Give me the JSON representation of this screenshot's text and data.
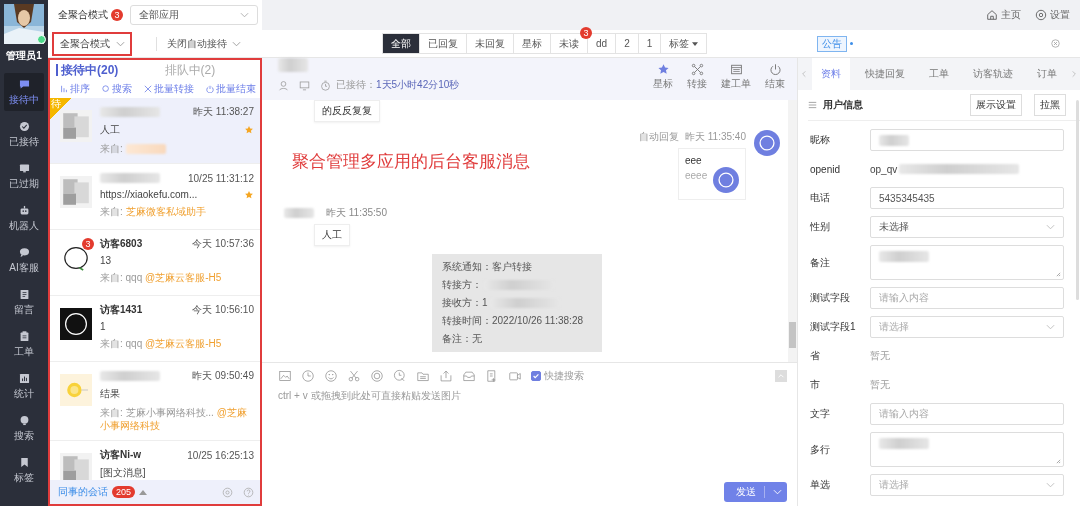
{
  "sidebar": {
    "user": "管理员1",
    "online": true,
    "items": [
      {
        "label": "接待中",
        "selected": true
      },
      {
        "label": "已接待",
        "selected": false
      },
      {
        "label": "已过期",
        "selected": false
      },
      {
        "label": "机器人",
        "selected": false
      },
      {
        "label": "AI客服",
        "selected": false
      },
      {
        "label": "留言",
        "selected": false
      },
      {
        "label": "工单",
        "selected": false
      },
      {
        "label": "统计",
        "selected": false
      },
      {
        "label": "搜索",
        "selected": false
      },
      {
        "label": "标签",
        "selected": false
      }
    ]
  },
  "top_bar": {
    "mode": "全聚合模式",
    "mode_badge": "3",
    "app_select": "全部应用",
    "links": [
      "主页",
      "设置"
    ]
  },
  "toolbar": {
    "mode_select": {
      "value": "全聚合模式",
      "highlighted": true
    },
    "auto_reception": "关闭自动接待",
    "filters": [
      {
        "label": "全部",
        "selected": true
      },
      {
        "label": "已回复",
        "selected": false
      },
      {
        "label": "未回复",
        "selected": false
      },
      {
        "label": "星标",
        "selected": false
      },
      {
        "label": "未读",
        "selected": false,
        "badge": "3"
      },
      {
        "label": "dd",
        "selected": false
      },
      {
        "label": "2",
        "selected": false
      },
      {
        "label": "1",
        "selected": false
      },
      {
        "label": "标签",
        "selected": false,
        "dropdown": true
      }
    ],
    "notice": "公告"
  },
  "conversations": {
    "highlighted": true,
    "tabs": [
      {
        "label": "接待中(20)",
        "selected": true
      },
      {
        "label": "排队中(2)",
        "selected": false
      }
    ],
    "actions": [
      "排序",
      "搜索",
      "批量转接",
      "批量结束"
    ],
    "items": [
      {
        "name_redacted": true,
        "time": "昨天 11:38:27",
        "message": "人工",
        "source_label": "来自:",
        "source_redacted": true,
        "starred": true,
        "selected": true,
        "corner_tag": "待"
      },
      {
        "name_redacted": true,
        "time": "10/25 11:31:12",
        "message": "https://xiaokefu.com...",
        "source_label": "来自:",
        "source_app": "芝麻微客私域助手",
        "starred": true,
        "selected": false
      },
      {
        "name": "访客6803",
        "badge": "3",
        "time": "今天 10:57:36",
        "message": "13",
        "source_label": "来自: qqq",
        "source_app": "@芝麻云客服-H5",
        "starred": false,
        "selected": false
      },
      {
        "name": "访客1431",
        "time": "今天 10:56:10",
        "message": "1",
        "source_label": "来自: qqq",
        "source_app": "@芝麻云客服-H5",
        "starred": false,
        "selected": false
      },
      {
        "name_redacted": true,
        "time": "昨天 09:50:49",
        "message": "结果",
        "source_label": "来自: 芝麻小事网络科技...",
        "source_app": "@芝麻小事网络科技",
        "starred": false,
        "selected": false
      },
      {
        "name": "访客Ni-w",
        "time": "10/25 16:25:13",
        "message": "[图文消息]",
        "starred": false,
        "selected": false
      }
    ],
    "footer": {
      "label": "同事的会话",
      "count": "205"
    }
  },
  "chat": {
    "elapsed_label": "已接待：",
    "elapsed": "1天5小时42分10秒",
    "actions": [
      "星标",
      "转接",
      "建工单",
      "结束"
    ],
    "annotation": "聚合管理多应用的后台客服消息",
    "messages": [
      {
        "kind": "visitor",
        "text": "的反反复复"
      },
      {
        "kind": "agent",
        "tag": "自动回复",
        "time": "昨天 11:35:40",
        "lines": [
          "eee",
          "eeee"
        ]
      },
      {
        "kind": "visitor",
        "name_redacted": true,
        "time": "昨天 11:35:50",
        "text": "人工"
      },
      {
        "kind": "notice",
        "lines": [
          {
            "text": "系统通知：客户转接"
          },
          {
            "text": "转接方：",
            "redacted": true
          },
          {
            "text": "接收方：1",
            "redacted": true
          },
          {
            "text": "转接时间：2022/10/26 11:38:28"
          },
          {
            "text": "备注：无"
          }
        ]
      }
    ],
    "input": {
      "quick_search": {
        "label": "快捷搜索",
        "checked": true
      },
      "placeholder": "ctrl + v 或拖拽到此处可直接粘贴发送图片",
      "send": "发送"
    }
  },
  "profile": {
    "tabs": [
      {
        "label": "资料",
        "selected": true
      },
      {
        "label": "快捷回复",
        "selected": false
      },
      {
        "label": "工单",
        "selected": false
      },
      {
        "label": "访客轨迹",
        "selected": false
      },
      {
        "label": "订单",
        "selected": false
      }
    ],
    "title": "用户信息",
    "buttons": [
      "展示设置",
      "拉黑"
    ],
    "fields": [
      {
        "label": "昵称",
        "kind": "input",
        "redacted": true
      },
      {
        "label": "openid",
        "kind": "text",
        "value": "op_qv",
        "redacted": true
      },
      {
        "label": "电话",
        "kind": "input",
        "value": "5435345435"
      },
      {
        "label": "性别",
        "kind": "select",
        "value": "未选择"
      },
      {
        "label": "备注",
        "kind": "textarea",
        "redacted": true
      },
      {
        "label": "测试字段",
        "kind": "input",
        "placeholder": "请输入内容"
      },
      {
        "label": "测试字段1",
        "kind": "select",
        "placeholder": "请选择"
      },
      {
        "label": "省",
        "kind": "empty",
        "value": "暂无"
      },
      {
        "label": "市",
        "kind": "empty",
        "value": "暂无"
      },
      {
        "label": "文字",
        "kind": "input",
        "placeholder": "请输入内容"
      },
      {
        "label": "多行",
        "kind": "textarea",
        "redacted": true
      },
      {
        "label": "单选",
        "kind": "select",
        "placeholder": "请选择"
      }
    ]
  }
}
